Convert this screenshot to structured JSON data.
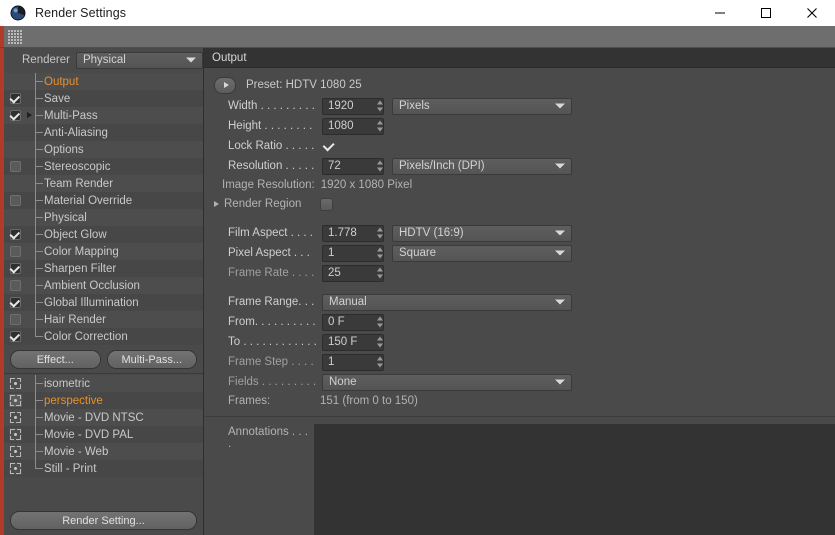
{
  "window": {
    "title": "Render Settings",
    "app_icon": "c4d-sphere-icon",
    "controls": {
      "minimize": "minimize-icon",
      "maximize": "maximize-icon",
      "close": "close-icon"
    }
  },
  "toolbar": {
    "grip": "drag-grip-handle"
  },
  "sidebar": {
    "renderer": {
      "label": "Renderer",
      "value": "Physical"
    },
    "tree": [
      {
        "label": "Output",
        "check": "none",
        "active": true,
        "expander": false,
        "last": false
      },
      {
        "label": "Save",
        "check": "checked",
        "active": false,
        "expander": false,
        "last": false
      },
      {
        "label": "Multi-Pass",
        "check": "checked",
        "active": false,
        "expander": true,
        "last": false
      },
      {
        "label": "Anti-Aliasing",
        "check": "none",
        "active": false,
        "expander": false,
        "last": false
      },
      {
        "label": "Options",
        "check": "none",
        "active": false,
        "expander": false,
        "last": false
      },
      {
        "label": "Stereoscopic",
        "check": "unchecked",
        "active": false,
        "expander": false,
        "last": false
      },
      {
        "label": "Team Render",
        "check": "none",
        "active": false,
        "expander": false,
        "last": false
      },
      {
        "label": "Material Override",
        "check": "unchecked",
        "active": false,
        "expander": false,
        "last": false
      },
      {
        "label": "Physical",
        "check": "none",
        "active": false,
        "expander": false,
        "last": false
      },
      {
        "label": "Object Glow",
        "check": "checked",
        "active": false,
        "expander": false,
        "last": false
      },
      {
        "label": "Color Mapping",
        "check": "unchecked",
        "active": false,
        "expander": false,
        "last": false
      },
      {
        "label": "Sharpen Filter",
        "check": "checked",
        "active": false,
        "expander": false,
        "last": false
      },
      {
        "label": "Ambient Occlusion",
        "check": "unchecked",
        "active": false,
        "expander": false,
        "last": false
      },
      {
        "label": "Global Illumination",
        "check": "checked",
        "active": false,
        "expander": false,
        "last": false
      },
      {
        "label": "Hair Render",
        "check": "unchecked",
        "active": false,
        "expander": false,
        "last": false
      },
      {
        "label": "Color Correction",
        "check": "checked",
        "active": false,
        "expander": false,
        "last": true
      }
    ],
    "buttons": {
      "effect": "Effect...",
      "multipass": "Multi-Pass..."
    },
    "presets": [
      {
        "label": "isometric",
        "active": false,
        "last": false
      },
      {
        "label": "perspective",
        "active": true,
        "last": false
      },
      {
        "label": "Movie - DVD NTSC",
        "active": false,
        "last": false
      },
      {
        "label": "Movie - DVD PAL",
        "active": false,
        "last": false
      },
      {
        "label": "Movie - Web",
        "active": false,
        "last": false
      },
      {
        "label": "Still - Print",
        "active": false,
        "last": true
      }
    ],
    "bottom_button": "Render Setting..."
  },
  "output": {
    "section_title": "Output",
    "preset": {
      "button": "expand-preset-button",
      "text": "Preset: HDTV 1080 25"
    },
    "width": {
      "label": "Width . . . . . . . . .",
      "value": "1920",
      "unit": "Pixels"
    },
    "height": {
      "label": "Height . . . . . . . .",
      "value": "1080"
    },
    "lock_ratio": {
      "label": "Lock Ratio . . . . .",
      "checked": true
    },
    "resolution": {
      "label": "Resolution . . . . .",
      "value": "72",
      "unit": "Pixels/Inch (DPI)"
    },
    "image_resolution": {
      "label": "Image Resolution:",
      "value": "1920 x 1080 Pixel"
    },
    "render_region": {
      "label": "Render Region",
      "checked": false
    },
    "film_aspect": {
      "label": "Film Aspect . . . .",
      "value": "1.778",
      "preset": "HDTV (16:9)"
    },
    "pixel_aspect": {
      "label": "Pixel Aspect . . .",
      "value": "1",
      "preset": "Square"
    },
    "frame_rate": {
      "label": "Frame Rate . . . .",
      "value": "25"
    },
    "frame_range": {
      "label": "Frame Range. . .",
      "value": "Manual"
    },
    "from": {
      "label": "From. . . . . . . . . .",
      "value": "0 F"
    },
    "to": {
      "label": "To . . . . . . . . . . . .",
      "value": "150 F"
    },
    "frame_step": {
      "label": "Frame Step . . . .",
      "value": "1"
    },
    "fields": {
      "label": "Fields . . . . . . . . .",
      "value": "None"
    },
    "frames": {
      "label": "Frames:",
      "value": "151 (from 0 to 150)"
    },
    "annotations": {
      "label": "Annotations . . . .",
      "value": ""
    }
  },
  "colors": {
    "accent_orange": "#e8902a",
    "panel_bg": "#4a4a4a",
    "header_bg": "#333333",
    "red_bar": "#b03a2c",
    "titlebar_bg": "#ffffff"
  }
}
